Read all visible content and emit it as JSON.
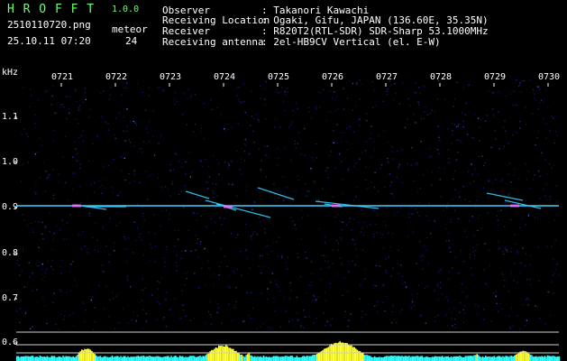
{
  "header": {
    "app_name": "H R O F F T",
    "version": "1.0.0",
    "filename": "2510110720.png",
    "datetime": "25.10.11 07:20",
    "meteor_label": "meteor",
    "meteor_count": "24",
    "info": [
      {
        "label": "Observer",
        "value": ": Takanori Kawachi"
      },
      {
        "label": "Receiving Location",
        "value": ": Ogaki, Gifu, JAPAN (136.60E, 35.35N)"
      },
      {
        "label": "Receiver",
        "value": ": R820T2(RTL-SDR) SDR-Sharp 53.1000MHz"
      },
      {
        "label": "Receiving antenna",
        "value": ": 2el-HB9CV Vertical (el. E-W)"
      }
    ]
  },
  "spectrogram": {
    "y_unit": "kHz",
    "y_ticks": [
      "1.1",
      "1.0",
      "0.9",
      "0.8",
      "0.7",
      "0.6"
    ],
    "x_ticks": [
      "0721",
      "0722",
      "0723",
      "0724",
      "0725",
      "0726",
      "0727",
      "0728",
      "0729",
      "0730"
    ],
    "colors": {
      "background": "#000000",
      "noise": "#1a1a8c",
      "signal": "#33ccff",
      "strong": "#ff66ff",
      "level": "#ffff33",
      "baseline": "#33ffff"
    }
  }
}
